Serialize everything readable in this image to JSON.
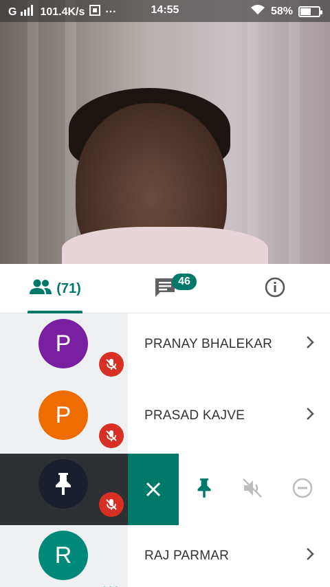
{
  "status_bar": {
    "network": "G",
    "speed": "101.4K/s",
    "more": "···",
    "time": "14:55",
    "battery": "58%",
    "battery_level": 0.58
  },
  "tabs": {
    "people_count": "(71)",
    "chat_badge": "46"
  },
  "participants": [
    {
      "initial": "P",
      "name": "PRANAY BHALEKAR",
      "avatar_color": "#7b1fa2",
      "muted": true
    },
    {
      "initial": "P",
      "name": "PRASAD KAJVE",
      "avatar_color": "#ef6c00",
      "muted": true
    },
    {
      "avatar_color": "#1a1f2e",
      "muted": true,
      "pinned_actions_open": true
    },
    {
      "initial": "R",
      "name": "RAJ PARMAR",
      "avatar_color": "#00897b",
      "more": "•••"
    }
  ],
  "colors": {
    "accent": "#00796b",
    "mute_red": "#d93025"
  }
}
